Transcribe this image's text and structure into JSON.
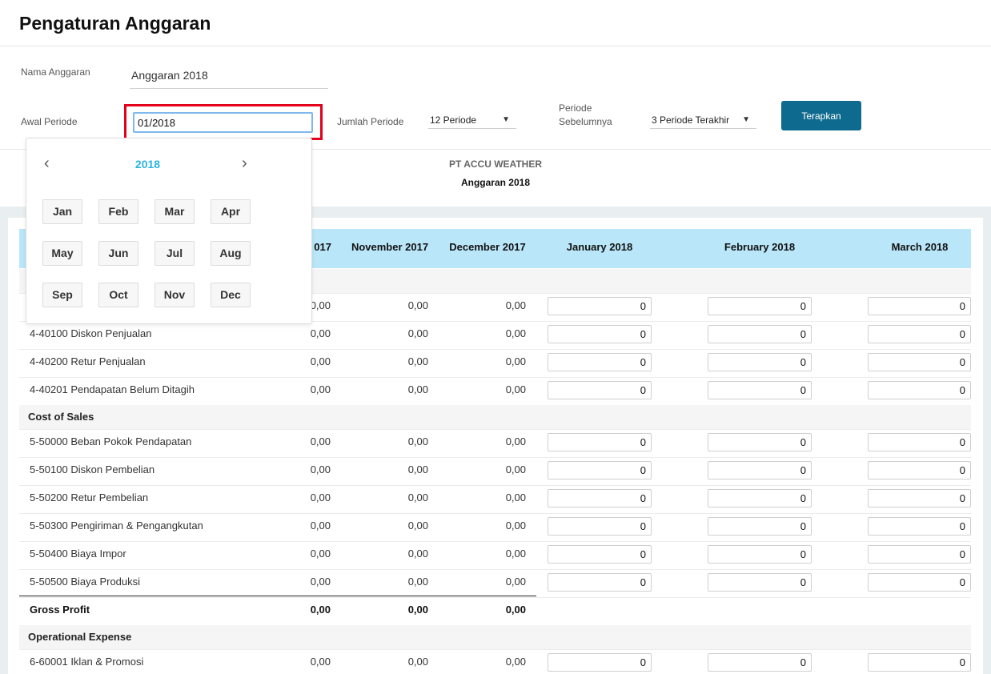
{
  "page": {
    "title": "Pengaturan Anggaran"
  },
  "form": {
    "name_label": "Nama Anggaran",
    "name_value": "Anggaran 2018",
    "start_label": "Awal Periode",
    "start_value": "01/2018",
    "count_label": "Jumlah Periode",
    "count_value": "12 Periode",
    "prev_label_1": "Periode",
    "prev_label_2": "Sebelumnya",
    "prev_value": "3 Periode Terakhir",
    "apply_label": "Terapkan"
  },
  "picker": {
    "year": "2018",
    "prev_icon": "‹",
    "next_icon": "›",
    "months": [
      "Jan",
      "Feb",
      "Mar",
      "Apr",
      "May",
      "Jun",
      "Jul",
      "Aug",
      "Sep",
      "Oct",
      "Nov",
      "Dec"
    ]
  },
  "report": {
    "company": "PT ACCU WEATHER",
    "subtitle": "Anggaran 2018"
  },
  "table": {
    "columns": [
      "017",
      "November 2017",
      "December 2017",
      "January 2018",
      "February 2018",
      "March 2018"
    ],
    "rows": [
      {
        "type": "account",
        "name": "",
        "hist": [
          "0,00",
          "0,00",
          "0,00"
        ],
        "inputs": [
          "0",
          "0",
          "0"
        ]
      },
      {
        "type": "account",
        "name": "4-40100 Diskon Penjualan",
        "hist": [
          "0,00",
          "0,00",
          "0,00"
        ],
        "inputs": [
          "0",
          "0",
          "0"
        ]
      },
      {
        "type": "account",
        "name": "4-40200 Retur Penjualan",
        "hist": [
          "0,00",
          "0,00",
          "0,00"
        ],
        "inputs": [
          "0",
          "0",
          "0"
        ]
      },
      {
        "type": "account",
        "name": "4-40201 Pendapatan Belum Ditagih",
        "hist": [
          "0,00",
          "0,00",
          "0,00"
        ],
        "inputs": [
          "0",
          "0",
          "0"
        ]
      },
      {
        "type": "section",
        "name": "Cost of Sales"
      },
      {
        "type": "account",
        "name": "5-50000 Beban Pokok Pendapatan",
        "hist": [
          "0,00",
          "0,00",
          "0,00"
        ],
        "inputs": [
          "0",
          "0",
          "0"
        ]
      },
      {
        "type": "account",
        "name": "5-50100 Diskon Pembelian",
        "hist": [
          "0,00",
          "0,00",
          "0,00"
        ],
        "inputs": [
          "0",
          "0",
          "0"
        ]
      },
      {
        "type": "account",
        "name": "5-50200 Retur Pembelian",
        "hist": [
          "0,00",
          "0,00",
          "0,00"
        ],
        "inputs": [
          "0",
          "0",
          "0"
        ]
      },
      {
        "type": "account",
        "name": "5-50300 Pengiriman & Pengangkutan",
        "hist": [
          "0,00",
          "0,00",
          "0,00"
        ],
        "inputs": [
          "0",
          "0",
          "0"
        ]
      },
      {
        "type": "account",
        "name": "5-50400 Biaya Impor",
        "hist": [
          "0,00",
          "0,00",
          "0,00"
        ],
        "inputs": [
          "0",
          "0",
          "0"
        ]
      },
      {
        "type": "account",
        "name": "5-50500 Biaya Produksi",
        "hist": [
          "0,00",
          "0,00",
          "0,00"
        ],
        "inputs": [
          "0",
          "0",
          "0"
        ]
      },
      {
        "type": "total",
        "name": "Gross Profit",
        "hist": [
          "0,00",
          "0,00",
          "0,00"
        ]
      },
      {
        "type": "section",
        "name": "Operational Expense"
      },
      {
        "type": "account",
        "name": "6-60001 Iklan & Promosi",
        "hist": [
          "0,00",
          "0,00",
          "0,00"
        ],
        "inputs": [
          "0",
          "0",
          "0"
        ]
      }
    ]
  }
}
